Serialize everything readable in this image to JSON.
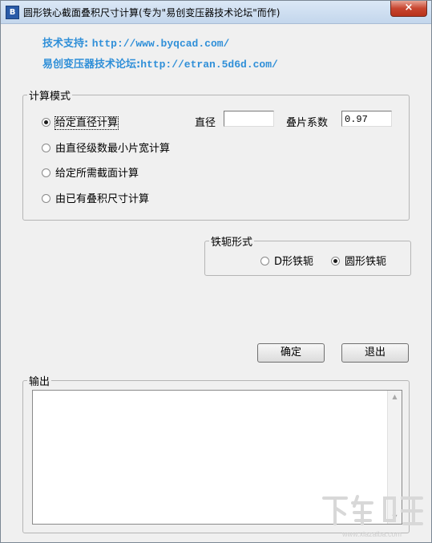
{
  "window": {
    "title": "圆形铁心截面叠积尺寸计算(专为\"易创变压器技术论坛\"而作)",
    "icon_letter": "B",
    "close_label": "×"
  },
  "links": {
    "support_label": "技术支持:",
    "support_url": "http://www.byqcad.com/",
    "forum_label": "易创变压器技术论坛:",
    "forum_url": "http://etran.5d6d.com/"
  },
  "calc_mode": {
    "label": "计算模式",
    "options": [
      {
        "label": "给定直径计算",
        "checked": true
      },
      {
        "label": "由直径级数最小片宽计算",
        "checked": false
      },
      {
        "label": "给定所需截面计算",
        "checked": false
      },
      {
        "label": "由已有叠积尺寸计算",
        "checked": false
      }
    ],
    "diameter_label": "直径",
    "diameter_value": "",
    "stack_factor_label": "叠片系数",
    "stack_factor_value": "0.97"
  },
  "yoke": {
    "label": "铁轭形式",
    "options": [
      {
        "label": "D形铁轭",
        "checked": false
      },
      {
        "label": "圆形铁轭",
        "checked": true
      }
    ]
  },
  "buttons": {
    "ok_label": "确定",
    "exit_label": "退出"
  },
  "output": {
    "label": "输出",
    "value": ""
  },
  "colors": {
    "link": "#2f8fd8",
    "close_button": "#c7452f",
    "titlebar": "#c3d6ec"
  },
  "watermark": {
    "text": "下载吧",
    "url": "www.xiazaiba.com"
  }
}
